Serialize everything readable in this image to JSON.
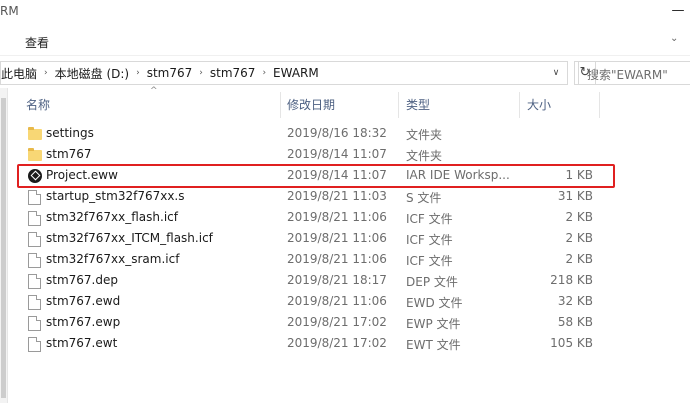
{
  "window": {
    "title_fragment": "RM",
    "minimize_glyph": "—"
  },
  "ribbon": {
    "view_tab": "查看",
    "expand_glyph": "⌄"
  },
  "address": {
    "crumbs": [
      "此电脑",
      "本地磁盘 (D:)",
      "stm767",
      "stm767",
      "EWARM"
    ],
    "separator": "›",
    "dropdown_glyph": "∨",
    "refresh_glyph": "↻"
  },
  "search": {
    "placeholder": "搜索\"EWARM\""
  },
  "columns": {
    "name": "名称",
    "date": "修改日期",
    "type": "类型",
    "size": "大小",
    "sort_glyph": "^"
  },
  "files": [
    {
      "name": "settings",
      "date": "2019/8/16 18:32",
      "type": "文件夹",
      "size": "",
      "icon": "folder-icon"
    },
    {
      "name": "stm767",
      "date": "2019/8/14 11:07",
      "type": "文件夹",
      "size": "",
      "icon": "folder-icon"
    },
    {
      "name": "Project.eww",
      "date": "2019/8/14 11:07",
      "type": "IAR IDE Worksp...",
      "size": "1 KB",
      "icon": "iar-workspace-icon"
    },
    {
      "name": "startup_stm32f767xx.s",
      "date": "2019/8/21 11:03",
      "type": "S 文件",
      "size": "31 KB",
      "icon": "file-icon"
    },
    {
      "name": "stm32f767xx_flash.icf",
      "date": "2019/8/21 11:06",
      "type": "ICF 文件",
      "size": "2 KB",
      "icon": "file-icon"
    },
    {
      "name": "stm32f767xx_ITCM_flash.icf",
      "date": "2019/8/21 11:06",
      "type": "ICF 文件",
      "size": "2 KB",
      "icon": "file-icon"
    },
    {
      "name": "stm32f767xx_sram.icf",
      "date": "2019/8/21 11:06",
      "type": "ICF 文件",
      "size": "2 KB",
      "icon": "file-icon"
    },
    {
      "name": "stm767.dep",
      "date": "2019/8/21 18:17",
      "type": "DEP 文件",
      "size": "218 KB",
      "icon": "file-icon"
    },
    {
      "name": "stm767.ewd",
      "date": "2019/8/21 11:06",
      "type": "EWD 文件",
      "size": "32 KB",
      "icon": "file-icon"
    },
    {
      "name": "stm767.ewp",
      "date": "2019/8/21 17:02",
      "type": "EWP 文件",
      "size": "58 KB",
      "icon": "file-icon"
    },
    {
      "name": "stm767.ewt",
      "date": "2019/8/21 17:02",
      "type": "EWT 文件",
      "size": "105 KB",
      "icon": "file-icon"
    }
  ],
  "colors": {
    "highlight": "#e02020",
    "folder": "#f8d775",
    "header_text": "#4d6082"
  }
}
